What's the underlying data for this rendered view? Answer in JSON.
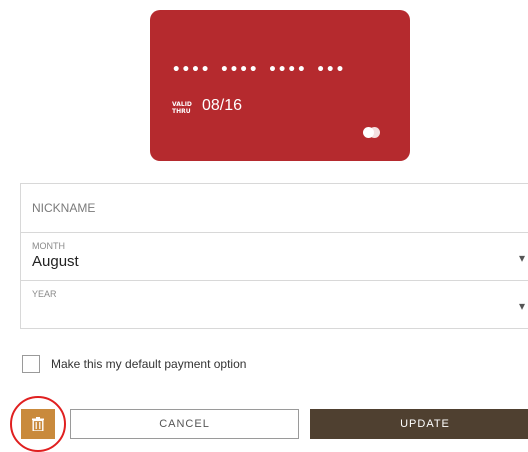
{
  "card": {
    "number_masked": "•••• •••• •••• •••",
    "valid_thru_line1": "VALID",
    "valid_thru_line2": "THRU",
    "expiry": "08/16",
    "brand_icon": "mastercard-logo-icon",
    "color": "#b52a2e"
  },
  "form": {
    "nickname": {
      "placeholder": "NICKNAME",
      "value": ""
    },
    "month": {
      "label": "MONTH",
      "value": "August"
    },
    "year": {
      "label": "YEAR",
      "value": ""
    }
  },
  "default_payment": {
    "label": "Make this my default payment option",
    "checked": false
  },
  "actions": {
    "delete_icon": "trash-icon",
    "cancel_label": "CANCEL",
    "update_label": "UPDATE",
    "delete_color": "#c98a3c",
    "update_color": "#4f4030",
    "highlight_color": "#e02020"
  }
}
